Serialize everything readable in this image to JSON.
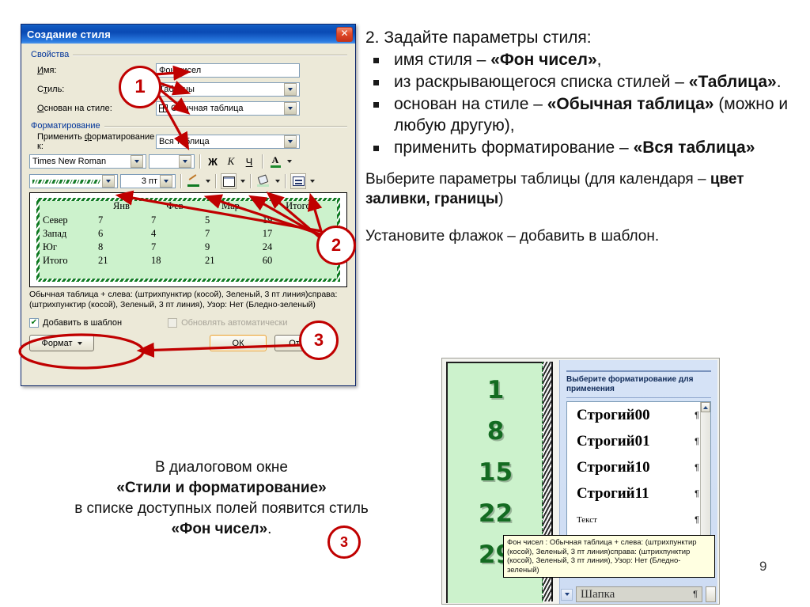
{
  "dialog": {
    "title": "Создание стиля",
    "close_label": "✕",
    "groups": {
      "properties": "Свойства",
      "formatting": "Форматирование"
    },
    "fields": [
      {
        "label": "Имя:",
        "value": "Фон чисел",
        "type": "text"
      },
      {
        "label": "Стиль:",
        "value": "Таблицы",
        "type": "combo"
      },
      {
        "label": "Основан на стиле:",
        "value": "Обычная таблица",
        "type": "combo-icon"
      },
      {
        "label": "Применить форматирование к:",
        "value": "Вся таблица",
        "type": "combo"
      }
    ],
    "toolbar_font": {
      "font_name": "Times New Roman",
      "font_size": "",
      "bold": "Ж",
      "italic": "К",
      "underline": "Ч",
      "font_color": "A"
    },
    "toolbar_border": {
      "border_style_label": "",
      "border_width": "3 пт",
      "pen_icon": "pen-icon",
      "borders_icon": "borders-icon",
      "fill_icon": "fill-color-icon",
      "align_icon": "align-icon"
    },
    "preview": {
      "columns": [
        "",
        "Янв",
        "Фев",
        "Мар",
        "Итого"
      ],
      "rows": [
        [
          "Север",
          "7",
          "7",
          "5",
          "19"
        ],
        [
          "Запад",
          "6",
          "4",
          "7",
          "17"
        ],
        [
          "Юг",
          "8",
          "7",
          "9",
          "24"
        ],
        [
          "Итого",
          "21",
          "18",
          "21",
          "60"
        ]
      ]
    },
    "description": "Обычная таблица + слева: (штрихпунктир (косой), Зеленый,  3 пт линия)справа: (штрихпунктир (косой), Зеленый,  3 пт линия), Узор: Нет (Бледно-зеленый)",
    "checkbox_add_to_template": {
      "label": "Добавить в шаблон",
      "checked": true,
      "mark": "✔"
    },
    "checkbox_auto_update": {
      "label": "Обновлять автоматически",
      "checked": false,
      "disabled": true
    },
    "buttons": {
      "format": "Формат",
      "ok": "ОК",
      "cancel": "Отмена"
    }
  },
  "callouts": {
    "one": "1",
    "two": "2",
    "three": "3",
    "three_b": "3"
  },
  "instructions": {
    "heading": "2. Задайте параметры стиля:",
    "bullets": [
      {
        "pre": "имя стиля – ",
        "bold": "«Фон чисел»",
        "post": ","
      },
      {
        "pre": "из раскрывающегося списка стилей – ",
        "bold": "«Таблица»",
        "post": "."
      },
      {
        "pre": "основан на стиле – ",
        "bold": "«Обычная таблица»",
        "post": " (можно и любую другую),"
      },
      {
        "pre": "применить форматирование – ",
        "bold": "«Вся таблица»",
        "post": ""
      }
    ],
    "para_table": {
      "pre": "Выберите параметры таблицы (для календаря – ",
      "bold": "цвет заливки, границы",
      "post": ")"
    },
    "para_flag": "Установите флажок – добавить в шаблон."
  },
  "bottom_text": {
    "line1": "В диалоговом окне",
    "line2_bold": "«Стили и форматирование»",
    "line3": "в списке доступных полей появится стиль",
    "line4_bold": "«Фон чисел»",
    "line4_post": "."
  },
  "styles_panel": {
    "title": "Выберите форматирование для применения",
    "items": [
      {
        "name": "Строгий00",
        "mark": "¶",
        "kind": "heading"
      },
      {
        "name": "Строгий01",
        "mark": "¶",
        "kind": "heading"
      },
      {
        "name": "Строгий10",
        "mark": "¶",
        "kind": "heading"
      },
      {
        "name": "Строгий11",
        "mark": "¶",
        "kind": "heading"
      },
      {
        "name": "Текст",
        "mark": "¶",
        "kind": "plain"
      }
    ],
    "selected_item": "Фон чисел",
    "bottom_item": {
      "name": "Шапка",
      "mark": "¶"
    },
    "tooltip": "Фон чисел : Обычная таблица + слева: (штрихпунктир (косой), Зеленый,  3 пт линия)справа: (штрихпунктир (косой), Зеленый,  3 пт линия), Узор: Нет (Бледно-зеленый)"
  },
  "calendar": {
    "numbers": [
      "1",
      "8",
      "15",
      "22",
      "29"
    ]
  },
  "page_number": "9",
  "colors": {
    "accent_red": "#c00000",
    "title_blue": "#0a4ab4",
    "green_fill": "#ccf2cc",
    "green_dark": "#136b21"
  }
}
